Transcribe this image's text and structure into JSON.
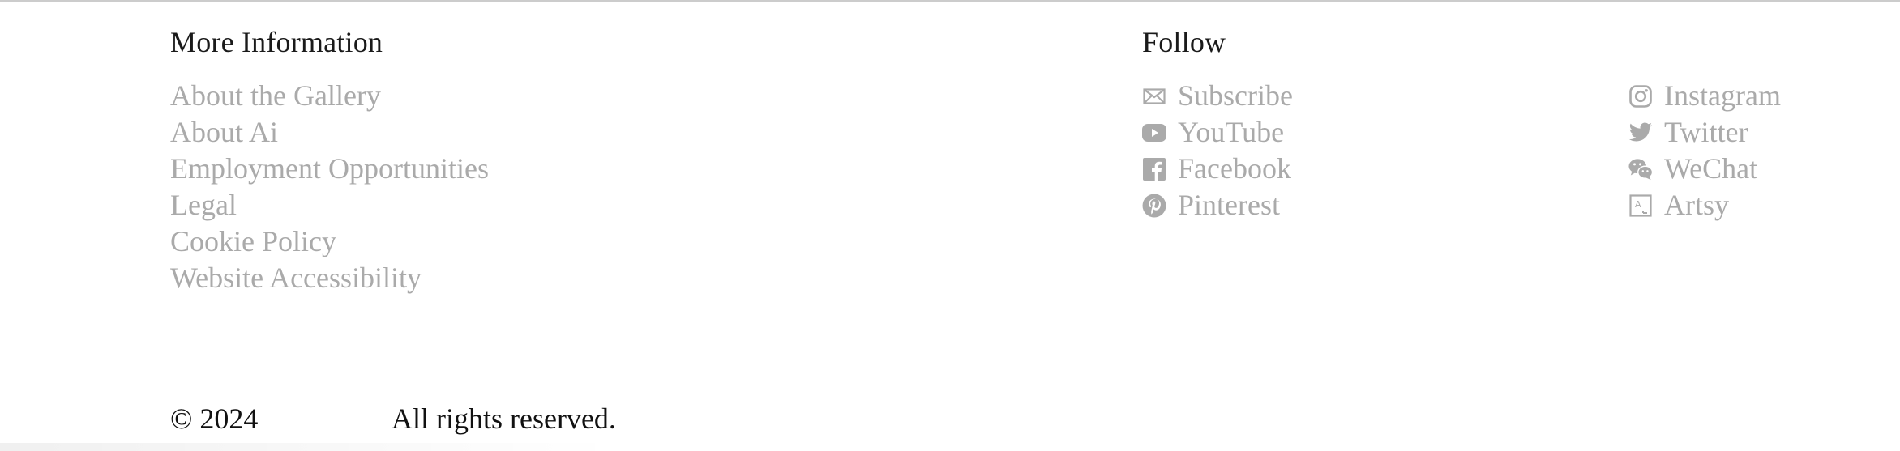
{
  "more_info": {
    "heading": "More Information",
    "links": [
      {
        "label": "About the Gallery"
      },
      {
        "label": "About Ai"
      },
      {
        "label": "Employment Opportunities"
      },
      {
        "label": "Legal"
      },
      {
        "label": "Cookie Policy"
      },
      {
        "label": "Website Accessibility"
      }
    ]
  },
  "follow": {
    "heading": "Follow",
    "left": [
      {
        "label": "Subscribe",
        "icon": "envelope-icon"
      },
      {
        "label": "YouTube",
        "icon": "youtube-icon"
      },
      {
        "label": "Facebook",
        "icon": "facebook-icon"
      },
      {
        "label": "Pinterest",
        "icon": "pinterest-icon"
      }
    ],
    "right": [
      {
        "label": "Instagram",
        "icon": "instagram-icon"
      },
      {
        "label": "Twitter",
        "icon": "twitter-icon"
      },
      {
        "label": "WeChat",
        "icon": "wechat-icon"
      },
      {
        "label": "Artsy",
        "icon": "artsy-icon"
      }
    ]
  },
  "footer": {
    "copyright": "© 2024",
    "rights": "All rights reserved."
  },
  "colors": {
    "link": "#aaaaaa",
    "heading": "#1a1a1a",
    "icon": "#aaaaaa"
  }
}
